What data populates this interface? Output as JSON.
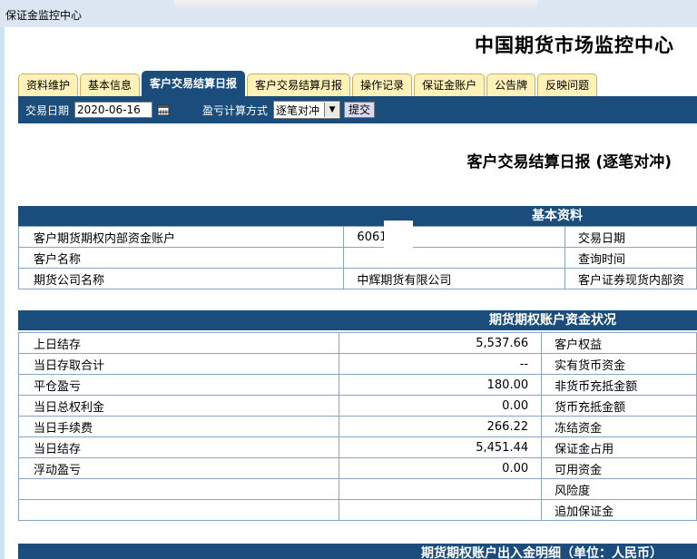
{
  "window": {
    "title": "保证金监控中心"
  },
  "header": {
    "title": "中国期货市场监控中心"
  },
  "tabs": [
    {
      "label": "资料维护",
      "active": false
    },
    {
      "label": "基本信息",
      "active": false
    },
    {
      "label": "客户交易结算日报",
      "active": true
    },
    {
      "label": "客户交易结算月报",
      "active": false
    },
    {
      "label": "操作记录",
      "active": false
    },
    {
      "label": "保证金账户",
      "active": false
    },
    {
      "label": "公告牌",
      "active": false
    },
    {
      "label": "反映问题",
      "active": false
    }
  ],
  "toolbar": {
    "date_label": "交易日期",
    "date_value": "2020-06-16",
    "method_label": "盈亏计算方式",
    "method_value": "逐笔对冲",
    "submit_label": "提交"
  },
  "report": {
    "title": "客户交易结算日报 (逐笔对冲)"
  },
  "basic": {
    "header": "基本资料",
    "rows": [
      {
        "label": "客户期货期权内部资金账户",
        "value": "6061",
        "right": "交易日期"
      },
      {
        "label": "客户名称",
        "value": "",
        "right": "查询时间"
      },
      {
        "label": "期货公司名称",
        "value": "中辉期货有限公司",
        "right": "客户证券现货内部资"
      }
    ]
  },
  "funds": {
    "header": "期货期权账户资金状况",
    "rows": [
      {
        "label": "上日结存",
        "value": "5,537.66",
        "right": "客户权益"
      },
      {
        "label": "当日存取合计",
        "value": "--",
        "right": "实有货币资金"
      },
      {
        "label": "平仓盈亏",
        "value": "180.00",
        "right": "非货币充抵金额"
      },
      {
        "label": "当日总权利金",
        "value": "0.00",
        "right": "货币充抵金额"
      },
      {
        "label": "当日手续费",
        "value": "266.22",
        "right": "冻结资金"
      },
      {
        "label": "当日结存",
        "value": "5,451.44",
        "right": "保证金占用"
      },
      {
        "label": "浮动盈亏",
        "value": "0.00",
        "right": "可用资金"
      },
      {
        "label": "",
        "value": "",
        "right": "风险度"
      },
      {
        "label": "",
        "value": "",
        "right": "追加保证金"
      }
    ]
  },
  "detail": {
    "header": "期货期权账户出入金明细（单位：人民币）"
  }
}
